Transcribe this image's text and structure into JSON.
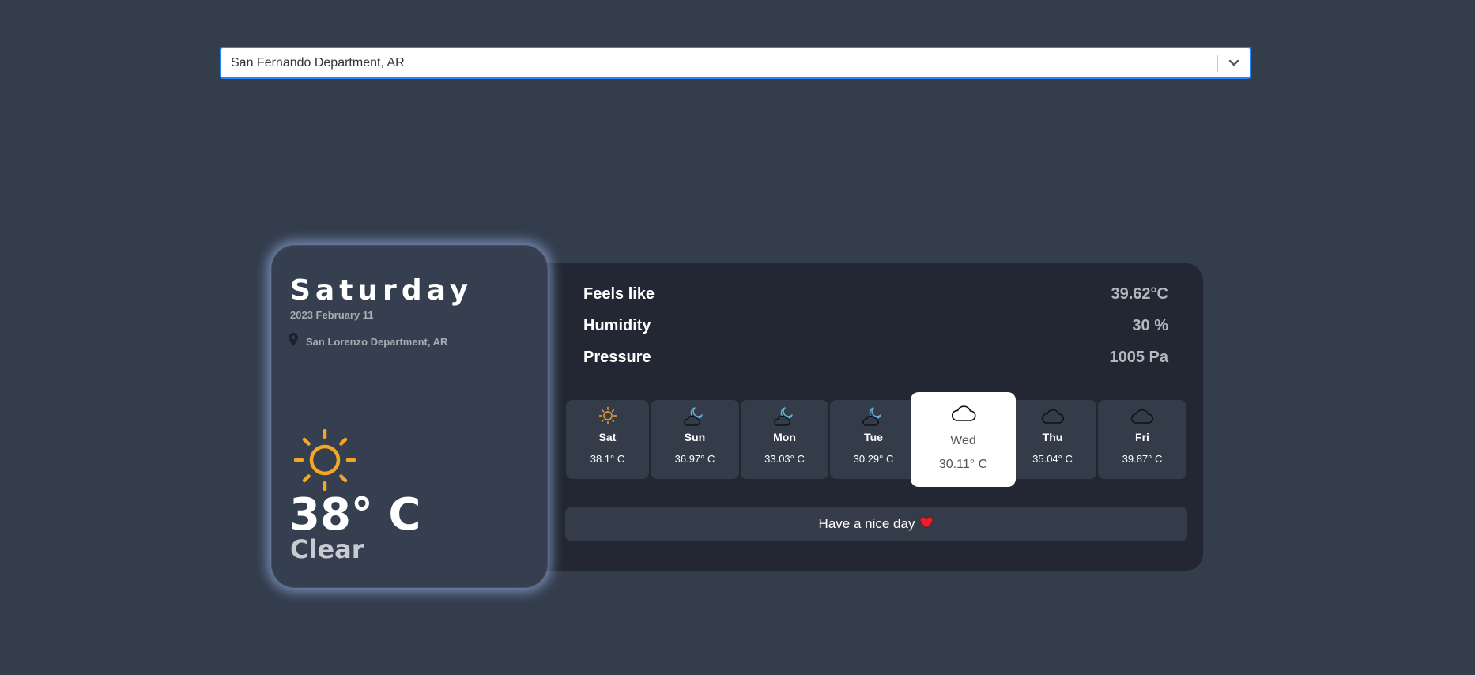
{
  "location_select": {
    "value": "San Fernando Department, AR"
  },
  "current": {
    "weekday": "Saturday",
    "date": "2023 February 11",
    "location": "San Lorenzo Department, AR",
    "icon": "sun-icon",
    "temperature": "38° C",
    "condition": "Clear"
  },
  "details": {
    "feels_like_label": "Feels like",
    "feels_like_value": "39.62°C",
    "humidity_label": "Humidity",
    "humidity_value": "30 %",
    "pressure_label": "Pressure",
    "pressure_value": "1005 Pa"
  },
  "forecast": [
    {
      "day": "Sat",
      "temp": "38.1° C",
      "icon": "sun-icon",
      "active": false
    },
    {
      "day": "Sun",
      "temp": "36.97° C",
      "icon": "cloud-moon-icon",
      "active": false
    },
    {
      "day": "Mon",
      "temp": "33.03° C",
      "icon": "cloud-moon-icon",
      "active": false
    },
    {
      "day": "Tue",
      "temp": "30.29° C",
      "icon": "cloud-moon-icon",
      "active": false
    },
    {
      "day": "Wed",
      "temp": "30.11° C",
      "icon": "cloud-icon",
      "active": true
    },
    {
      "day": "Thu",
      "temp": "35.04° C",
      "icon": "cloud-icon",
      "active": false
    },
    {
      "day": "Fri",
      "temp": "39.87° C",
      "icon": "cloud-icon",
      "active": false
    }
  ],
  "greeting": {
    "text": "Have a nice day",
    "icon": "heart-icon"
  },
  "colors": {
    "background": "#343d4c",
    "panel": "#222733",
    "sun": "#f5a623",
    "moon": "#5fb3d9",
    "heart": "#e8202a",
    "focus_border": "#2684ff"
  }
}
